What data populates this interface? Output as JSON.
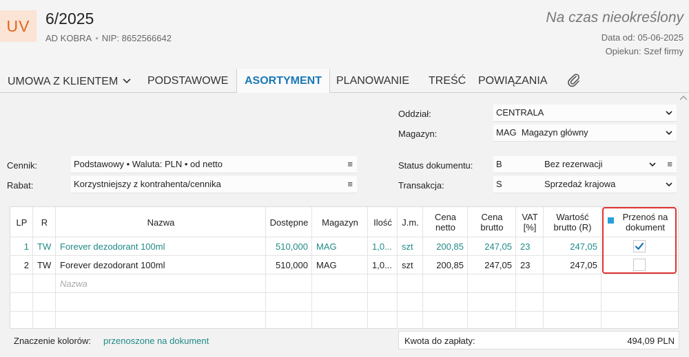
{
  "header": {
    "badge": "UV",
    "number": "6/2025",
    "company": "AD KOBRA",
    "nip": "NIP: 8652566642",
    "term": "Na czas nieokreślony",
    "date_from": "Data od: 05-06-2025",
    "guardian": "Opiekun: Szef firmy"
  },
  "tabs": [
    {
      "label": "UMOWA Z KLIENTEM",
      "dropdown": true
    },
    {
      "label": "PODSTAWOWE"
    },
    {
      "label": "ASORTYMENT",
      "active": true
    },
    {
      "label": "PLANOWANIE"
    },
    {
      "label": "TREŚĆ"
    },
    {
      "label": "POWIĄZANIA"
    }
  ],
  "form": {
    "branch_label": "Oddział:",
    "branch_value": "CENTRALA",
    "warehouse_label": "Magazyn:",
    "warehouse_code": "MAG",
    "warehouse_name": "Magazyn główny",
    "pricelist_label": "Cennik:",
    "pricelist_value": "Podstawowy • Waluta: PLN • od netto",
    "discount_label": "Rabat:",
    "discount_value": "Korzystniejszy z kontrahenta/cennika",
    "status_label": "Status dokumentu:",
    "status_code": "B",
    "status_name": "Bez rezerwacji",
    "transaction_label": "Transakcja:",
    "transaction_code": "S",
    "transaction_name": "Sprzedaż krajowa"
  },
  "grid": {
    "columns": {
      "lp": "LP",
      "r": "R",
      "name": "Nazwa",
      "available": "Dostępne",
      "warehouse": "Magazyn",
      "qty": "Ilość",
      "unit": "J.m.",
      "net_price": "Cena netto",
      "gross_price": "Cena brutto",
      "vat": "VAT [%]",
      "gross_value": "Wartość brutto (R)",
      "transfer": "Przenoś na dokument"
    },
    "rows": [
      {
        "lp": "1",
        "r": "TW",
        "name": "Forever dezodorant 100ml",
        "available": "510,000",
        "warehouse": "MAG",
        "qty": "1,0...",
        "unit": "szt",
        "net_price": "200,85",
        "gross_price": "247,05",
        "vat": "23",
        "gross_value": "247,05",
        "transfer": true
      },
      {
        "lp": "2",
        "r": "TW",
        "name": "Forever dezodorant 100ml",
        "available": "510,000",
        "warehouse": "MAG",
        "qty": "1,0...",
        "unit": "szt",
        "net_price": "200,85",
        "gross_price": "247,05",
        "vat": "23",
        "gross_value": "247,05",
        "transfer": false
      }
    ],
    "new_row_placeholder": "Nazwa"
  },
  "footer": {
    "legend_label": "Znaczenie kolorów:",
    "legend_value": "przenoszone na dokument",
    "total_label": "Kwota do zapłaty:",
    "total_value": "494,09 PLN"
  },
  "colors": {
    "accent": "#1a78b5",
    "teal": "#1e8a86",
    "badge_bg": "#fbe3d6",
    "badge_fg": "#e0661e",
    "highlight": "#e03131"
  }
}
